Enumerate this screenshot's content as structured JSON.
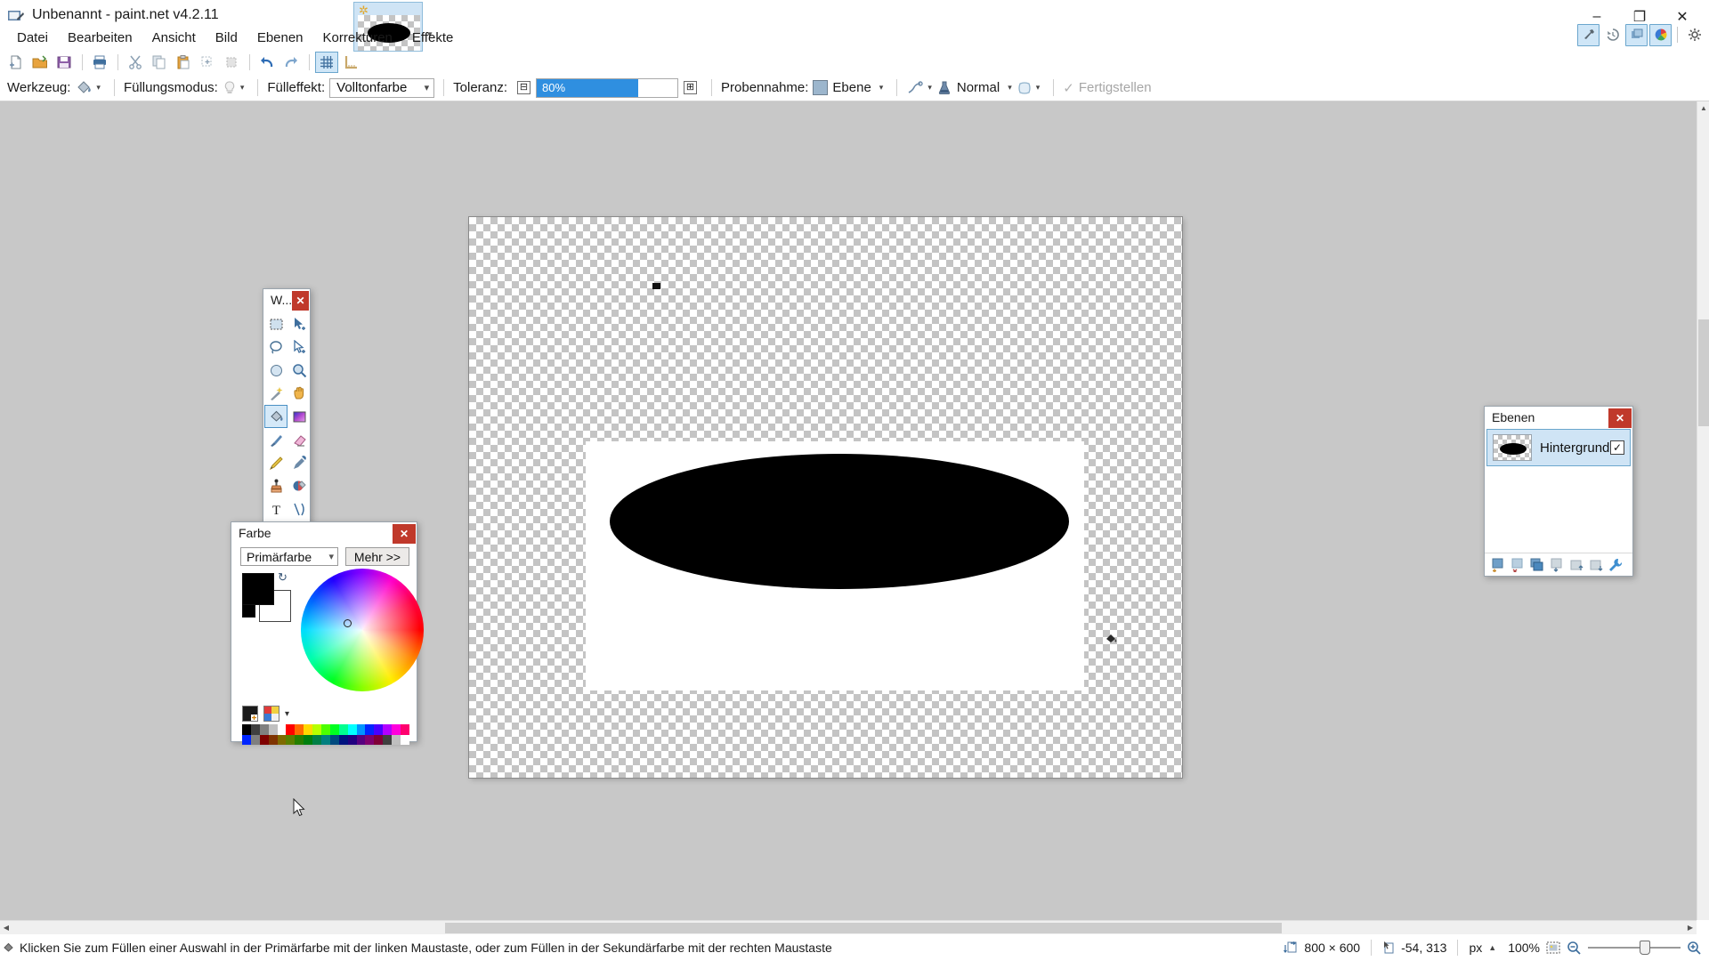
{
  "window": {
    "title": "Unbenannt - paint.net v4.2.11",
    "app_icon": "paintnet-icon",
    "minimize_label": "–",
    "maximize_label": "❐",
    "close_label": "✕"
  },
  "toolbar_toggles": [
    {
      "name": "tools-toggle",
      "icon": "hammer-icon",
      "glyph": "🔨",
      "active": true
    },
    {
      "name": "history-toggle",
      "icon": "history-icon",
      "glyph": "↺",
      "active": false
    },
    {
      "name": "layers-toggle",
      "icon": "layers-icon",
      "glyph": "▧",
      "active": true
    },
    {
      "name": "colors-toggle",
      "icon": "palette-icon",
      "glyph": "◕",
      "active": true
    },
    {
      "name": "settings-toggle",
      "icon": "gear-icon",
      "glyph": "⚙",
      "active": false
    },
    {
      "name": "help-toggle",
      "icon": "help-icon",
      "glyph": "?",
      "active": false
    }
  ],
  "menu": {
    "items": [
      {
        "label": "Datei"
      },
      {
        "label": "Bearbeiten"
      },
      {
        "label": "Ansicht"
      },
      {
        "label": "Bild"
      },
      {
        "label": "Ebenen"
      },
      {
        "label": "Korrekturen"
      },
      {
        "label": "Effekte"
      }
    ]
  },
  "icon_toolbar": [
    {
      "name": "new-button",
      "icon": "new-file-icon",
      "glyph": "⬜",
      "selected": false
    },
    {
      "name": "open-button",
      "icon": "open-folder-icon",
      "glyph": "📂",
      "selected": false
    },
    {
      "name": "save-button",
      "icon": "save-disk-icon",
      "glyph": "💾",
      "selected": false
    },
    {
      "name": "print-button",
      "icon": "printer-icon",
      "glyph": "🖨",
      "selected": false
    },
    {
      "name": "cut-button",
      "icon": "scissors-icon",
      "glyph": "✂",
      "selected": false
    },
    {
      "name": "copy-button",
      "icon": "copy-icon",
      "glyph": "⧉",
      "selected": false
    },
    {
      "name": "paste-button",
      "icon": "clipboard-icon",
      "glyph": "📋",
      "selected": false
    },
    {
      "name": "crop-button",
      "icon": "crop-icon",
      "glyph": "⌧",
      "selected": false
    },
    {
      "name": "deselect-button",
      "icon": "deselect-icon",
      "glyph": "▫",
      "selected": false
    },
    {
      "name": "undo-button",
      "icon": "undo-arrow-icon",
      "glyph": "↶",
      "selected": false
    },
    {
      "name": "redo-button",
      "icon": "redo-arrow-icon",
      "glyph": "↷",
      "selected": false
    },
    {
      "name": "grid-button",
      "icon": "grid-icon",
      "glyph": "⌗",
      "selected": true
    },
    {
      "name": "rulers-button",
      "icon": "ruler-icon",
      "glyph": "⎸",
      "selected": false
    }
  ],
  "tool_options": {
    "tool_label": "Werkzeug:",
    "tool_icon": "paint-bucket-icon",
    "fillmode_label": "Füllungsmodus:",
    "fillmode_icon": "bulb-icon",
    "filleffect_label": "Fülleffekt:",
    "filleffect_value": "Volltonfarbe",
    "tolerance_label": "Toleranz:",
    "tolerance_value": "80%",
    "tolerance_percent": 72,
    "tolerance_minus": "⊟",
    "tolerance_plus": "⊞",
    "sampling_label": "Probennahme:",
    "sampling_value": "Ebene",
    "antialias_icon": "antialias-icon",
    "blend_icon": "blend-jar-icon",
    "blend_value": "Normal",
    "shape_icon": "shape-icon",
    "finish_label": "Fertigstellen",
    "finish_check": "✓"
  },
  "tools_panel": {
    "title": "W...",
    "close_label": "✕",
    "tools": [
      {
        "name": "tool-rectangle-select",
        "icon": "rectangle-select-icon",
        "glyph": "⬚",
        "selected": false
      },
      {
        "name": "tool-move-selected",
        "icon": "move-selected-icon",
        "glyph": "➤",
        "selected": false
      },
      {
        "name": "tool-lasso-select",
        "icon": "lasso-select-icon",
        "glyph": "◯",
        "selected": false
      },
      {
        "name": "tool-move-selection",
        "icon": "move-selection-icon",
        "glyph": "▷",
        "selected": false
      },
      {
        "name": "tool-ellipse-select",
        "icon": "ellipse-select-icon",
        "glyph": "○",
        "selected": false
      },
      {
        "name": "tool-zoom",
        "icon": "magnifier-icon",
        "glyph": "🔍",
        "selected": false
      },
      {
        "name": "tool-magic-wand",
        "icon": "magic-wand-icon",
        "glyph": "✦",
        "selected": false
      },
      {
        "name": "tool-pan",
        "icon": "hand-icon",
        "glyph": "✋",
        "selected": false
      },
      {
        "name": "tool-paint-bucket",
        "icon": "paint-bucket-icon",
        "glyph": "🪣",
        "selected": true
      },
      {
        "name": "tool-gradient",
        "icon": "gradient-icon",
        "glyph": "▦",
        "selected": false
      },
      {
        "name": "tool-paintbrush",
        "icon": "paintbrush-icon",
        "glyph": "🖌",
        "selected": false
      },
      {
        "name": "tool-eraser",
        "icon": "eraser-icon",
        "glyph": "▱",
        "selected": false
      },
      {
        "name": "tool-pencil",
        "icon": "pencil-icon",
        "glyph": "✎",
        "selected": false
      },
      {
        "name": "tool-color-picker",
        "icon": "eyedropper-icon",
        "glyph": "✒",
        "selected": false
      },
      {
        "name": "tool-clone-stamp",
        "icon": "clone-stamp-icon",
        "glyph": "⬛",
        "selected": false
      },
      {
        "name": "tool-recolor",
        "icon": "recolor-icon",
        "glyph": "◐",
        "selected": false
      },
      {
        "name": "tool-text",
        "icon": "text-icon",
        "glyph": "T",
        "selected": false
      },
      {
        "name": "tool-line-curve",
        "icon": "line-curve-icon",
        "glyph": "⫻",
        "selected": false
      },
      {
        "name": "tool-shapes",
        "icon": "shapes-icon",
        "glyph": "■",
        "selected": false
      },
      {
        "name": "tool-shapes-alt",
        "icon": "triangle-shape-icon",
        "glyph": "△",
        "selected": false
      }
    ]
  },
  "colors_panel": {
    "title": "Farbe",
    "close_label": "✕",
    "mode_value": "Primärfarbe",
    "more_label": "Mehr >>",
    "primary_color": "#000000",
    "secondary_color": "#ffffff",
    "swap_icon": "swap-colors-icon",
    "palette_add_icon": "palette-add-icon",
    "palette_open_icon": "palette-open-icon",
    "palette_row1": [
      "#000000",
      "#404040",
      "#808080",
      "#c0c0c0",
      "#ffffff",
      "#ff0000",
      "#ff6a00",
      "#ffd800",
      "#b6ff00",
      "#4cff00",
      "#00ff21",
      "#00ff90",
      "#00ffff",
      "#0094ff",
      "#0026ff",
      "#4800ff",
      "#b200ff",
      "#ff00dc",
      "#ff006e"
    ],
    "palette_row2": [
      "#0026ff",
      "#7f7f7f",
      "#7f0000",
      "#7f3300",
      "#7f6a00",
      "#5b7f00",
      "#267f00",
      "#007f0e",
      "#007f46",
      "#007f7f",
      "#004a7f",
      "#00137f",
      "#21007f",
      "#57007f",
      "#7f006e",
      "#7f0037",
      "#3f3f3f",
      "#bfbfbf",
      "#ffffff"
    ]
  },
  "layers_panel": {
    "title": "Ebenen",
    "close_label": "✕",
    "layers": [
      {
        "name": "Hintergrund",
        "visible": true,
        "check": "✓"
      }
    ],
    "buttons": [
      {
        "name": "add-layer-button",
        "icon": "add-layer-icon",
        "glyph": "➕"
      },
      {
        "name": "delete-layer-button",
        "icon": "delete-layer-icon",
        "glyph": "✖"
      },
      {
        "name": "duplicate-layer-button",
        "icon": "duplicate-layer-icon",
        "glyph": "⧉"
      },
      {
        "name": "merge-layer-button",
        "icon": "merge-layer-icon",
        "glyph": "⬇"
      },
      {
        "name": "move-layer-up-button",
        "icon": "move-up-icon",
        "glyph": "⬆"
      },
      {
        "name": "move-layer-down-button",
        "icon": "move-down-icon",
        "glyph": "⬇"
      },
      {
        "name": "layer-properties-button",
        "icon": "wrench-icon",
        "glyph": "🔧"
      }
    ]
  },
  "canvas": {
    "document_thumb_icon": "document-thumbnail",
    "unsaved_icon": "unsaved-star-icon",
    "artwork": "black-ellipse-on-white-rectangle"
  },
  "status_bar": {
    "cursor_icon": "paint-bucket-cursor-icon",
    "hint": "Klicken Sie zum Füllen einer Auswahl in der Primärfarbe mit der linken Maustaste, oder zum Füllen in der Sekundärfarbe mit der rechten Maustaste",
    "image_size_icon": "image-size-icon",
    "image_size": "800 × 600",
    "cursor_pos_icon": "cursor-position-icon",
    "cursor_pos": "-54, 313",
    "units": "px",
    "units_caret": "▲",
    "zoom_level": "100%",
    "fit_icon": "fit-to-window-icon",
    "zoom_out_icon": "zoom-out-icon",
    "zoom_in_icon": "zoom-in-icon"
  }
}
